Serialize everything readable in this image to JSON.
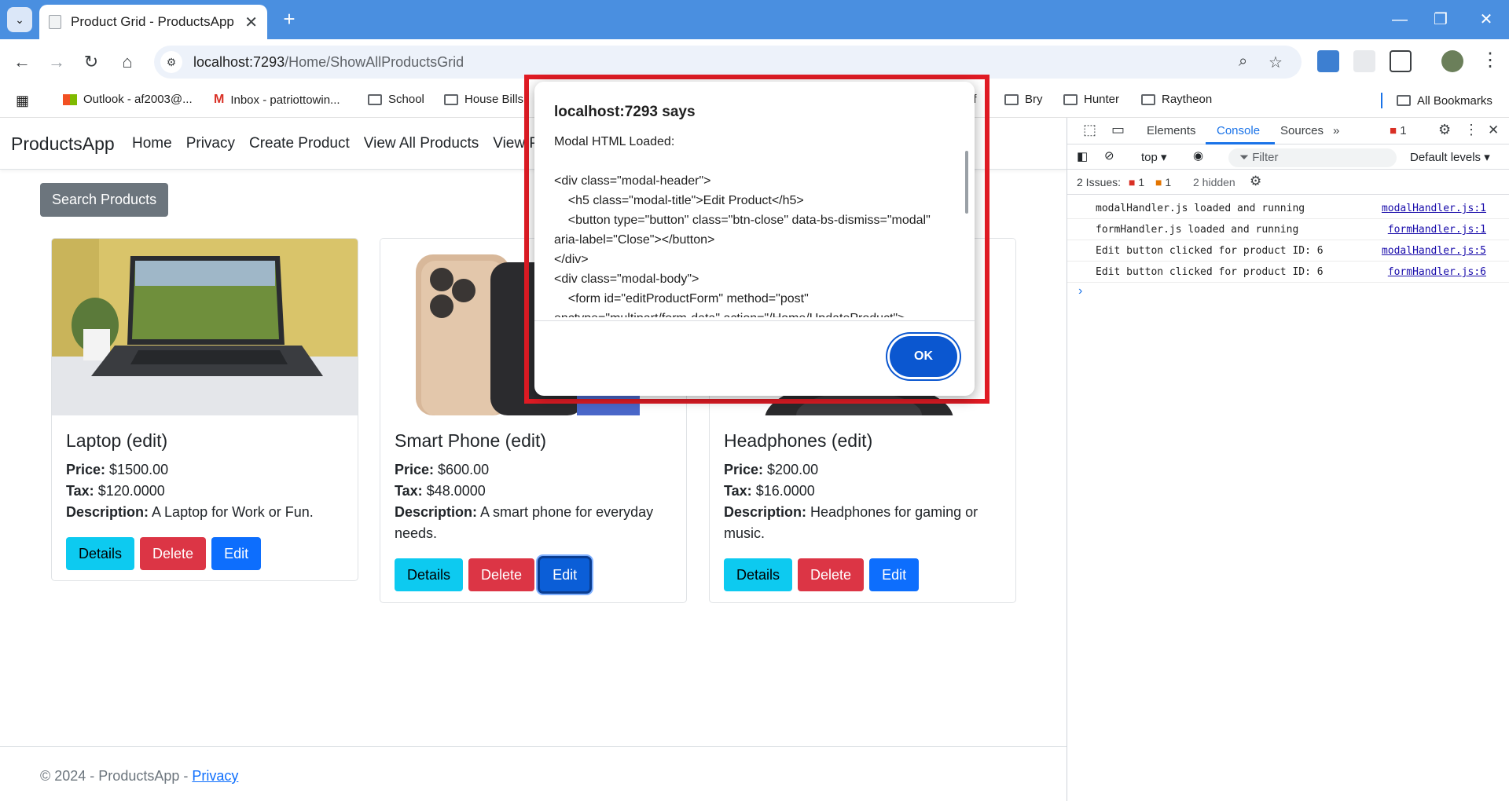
{
  "browser": {
    "tab_title": "Product Grid - ProductsApp",
    "url_host": "localhost:7293",
    "url_path": "/Home/ShowAllProductsGrid",
    "bookmarks": [
      "Outlook - af2003@...",
      "Inbox - patriottowin...",
      "School",
      "House Bills",
      "uf",
      "Bry",
      "Hunter",
      "Raytheon"
    ],
    "all_bookmarks": "All Bookmarks"
  },
  "app": {
    "brand": "ProductsApp",
    "nav": [
      "Home",
      "Privacy",
      "Create Product",
      "View All Products",
      "View Prod"
    ],
    "search_button": "Search Products",
    "products": [
      {
        "title": "Laptop (edit)",
        "price_label": "Price:",
        "price": "$1500.00",
        "tax_label": "Tax:",
        "tax": "$120.0000",
        "desc_label": "Description:",
        "desc": "A Laptop for Work or Fun."
      },
      {
        "title": "Smart Phone (edit)",
        "price_label": "Price:",
        "price": "$600.00",
        "tax_label": "Tax:",
        "tax": "$48.0000",
        "desc_label": "Description:",
        "desc": "A smart phone for everyday needs."
      },
      {
        "title": "Headphones (edit)",
        "price_label": "Price:",
        "price": "$200.00",
        "tax_label": "Tax:",
        "tax": "$16.0000",
        "desc_label": "Description:",
        "desc": "Headphones for gaming or music."
      }
    ],
    "buttons": {
      "details": "Details",
      "delete": "Delete",
      "edit": "Edit"
    },
    "footer": {
      "text": "© 2024 - ProductsApp - ",
      "link": "Privacy"
    }
  },
  "devtools": {
    "tabs": [
      "Elements",
      "Console",
      "Sources"
    ],
    "error_count": "1",
    "context": "top",
    "filter_placeholder": "Filter",
    "levels": "Default levels",
    "issues_label": "2 Issues:",
    "issues_errors": "1",
    "issues_warnings": "1",
    "hidden": "2 hidden",
    "console": [
      {
        "msg": "modalHandler.js loaded and running",
        "src": "modalHandler.js:1"
      },
      {
        "msg": "formHandler.js loaded and running",
        "src": "formHandler.js:1"
      },
      {
        "msg": "Edit button clicked for product ID: 6",
        "src": "modalHandler.js:5"
      },
      {
        "msg": "Edit button clicked for product ID: 6",
        "src": "formHandler.js:6"
      }
    ]
  },
  "dialog": {
    "title": "localhost:7293 says",
    "message": "Modal HTML Loaded:\n\n<div class=\"modal-header\">\n    <h5 class=\"modal-title\">Edit Product</h5>\n    <button type=\"button\" class=\"btn-close\" data-bs-dismiss=\"modal\" aria-label=\"Close\"></button>\n</div>\n<div class=\"modal-body\">\n    <form id=\"editProductForm\" method=\"post\" enctype=\"multipart/form-data\" action=\"/Home/UpdateProduct\">",
    "ok": "OK"
  },
  "colors": {
    "highlight_frame": "#e01b24",
    "chrome_blue": "#4a8fe0",
    "ok_button": "#0b57d0"
  }
}
